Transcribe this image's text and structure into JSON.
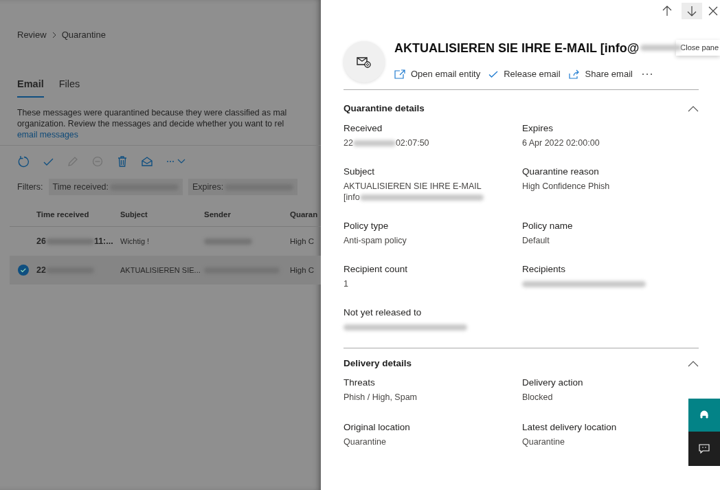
{
  "breadcrumb": [
    "Review",
    "Quarantine"
  ],
  "tabs": [
    {
      "label": "Email",
      "selected": true
    },
    {
      "label": "Files",
      "selected": false
    }
  ],
  "description": {
    "lines": [
      "These messages were quarantined because they were classified as mal",
      "organization. Review the messages and decide whether you want to rel"
    ],
    "link": "email messages"
  },
  "toolbar": [
    {
      "kind": "refresh",
      "disabled": false
    },
    {
      "kind": "check",
      "disabled": false
    },
    {
      "kind": "edit",
      "disabled": true
    },
    {
      "kind": "block",
      "disabled": true
    },
    {
      "kind": "delete",
      "disabled": false
    },
    {
      "kind": "preview",
      "disabled": false
    },
    {
      "kind": "more",
      "disabled": false
    }
  ],
  "filters": {
    "label": "Filters:",
    "chips": [
      "Time received:",
      "Expires:"
    ]
  },
  "table": {
    "columns": [
      "Time received",
      "Subject",
      "Sender",
      "Quaran"
    ],
    "rows": [
      {
        "selected": false,
        "time_start": "26",
        "time_end": "11:...",
        "subject": "Wichtig !",
        "column_4": "High C"
      },
      {
        "selected": true,
        "time_start": "22",
        "time_end": "",
        "subject": "AKTUALISIEREN SIE...",
        "column_4": "High C"
      }
    ]
  },
  "panel": {
    "tooltip": "Close pane",
    "title": "AKTUALISIEREN SIE IHRE E-MAIL [info@",
    "actions": [
      {
        "kind": "open",
        "label": "Open email entity"
      },
      {
        "kind": "release",
        "label": "Release email"
      },
      {
        "kind": "share",
        "label": "Share email"
      }
    ],
    "sections": [
      {
        "title": "Quarantine details",
        "expanded": true,
        "fields": [
          {
            "label": "Received",
            "value": [
              {
                "kind": "text",
                "text": "22"
              },
              {
                "kind": "redacted"
              },
              {
                "kind": "text",
                "text": "02:07:50"
              }
            ]
          },
          {
            "label": "Expires",
            "value": [
              {
                "kind": "text",
                "text": "6 Apr 2022 02:00:00"
              }
            ]
          },
          {
            "label": "Subject",
            "value": [
              {
                "kind": "text",
                "text": "AKTUALISIEREN SIE IHRE E-MAIL"
              },
              {
                "kind": "break"
              },
              {
                "kind": "text",
                "text": "[info"
              },
              {
                "kind": "redacted_long"
              }
            ]
          },
          {
            "label": "Quarantine reason",
            "value": [
              {
                "kind": "text",
                "text": "High Confidence Phish"
              }
            ]
          },
          {
            "label": "Policy type",
            "value": [
              {
                "kind": "text",
                "text": "Anti-spam policy"
              }
            ]
          },
          {
            "label": "Policy name",
            "value": [
              {
                "kind": "text",
                "text": "Default"
              }
            ]
          },
          {
            "label": "Recipient count",
            "value": [
              {
                "kind": "text",
                "text": "1"
              }
            ]
          },
          {
            "label": "Recipients",
            "value": [
              {
                "kind": "redacted_long"
              }
            ]
          },
          {
            "label": "Not yet released to",
            "value": [
              {
                "kind": "redacted_long"
              }
            ]
          }
        ]
      },
      {
        "title": "Delivery details",
        "expanded": true,
        "fields": [
          {
            "label": "Threats",
            "value": [
              {
                "kind": "text",
                "text": "Phish / High, Spam"
              }
            ]
          },
          {
            "label": "Delivery action",
            "value": [
              {
                "kind": "text",
                "text": "Blocked"
              }
            ]
          },
          {
            "label": "Original location",
            "value": [
              {
                "kind": "text",
                "text": "Quarantine"
              }
            ]
          },
          {
            "label": "Latest delivery location",
            "value": [
              {
                "kind": "text",
                "text": "Quarantine"
              }
            ]
          }
        ]
      }
    ]
  }
}
